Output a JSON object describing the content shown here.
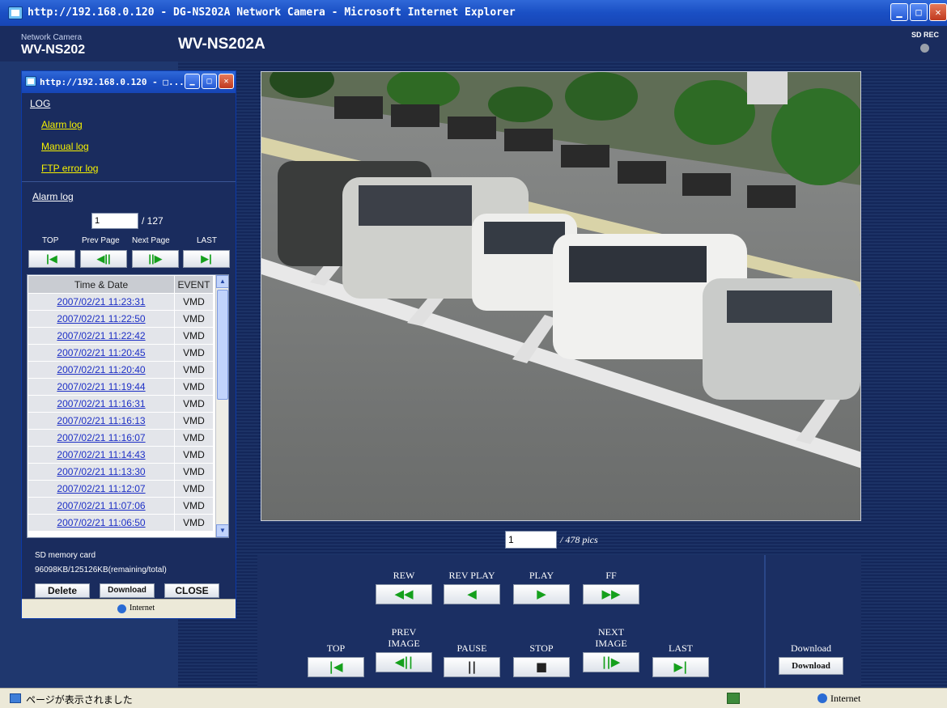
{
  "browser": {
    "title": "http://192.168.0.120 - DG-NS202A Network Camera - Microsoft Internet Explorer",
    "status_text": "ページが表示されました",
    "zone": "Internet"
  },
  "camera": {
    "label_small": "Network Camera",
    "model_small": "WV-NS202",
    "model": "WV-NS202A",
    "sd_rec": "SD REC"
  },
  "playback": {
    "current_pic": "1",
    "total_pics": "/ 478 pics",
    "rew": "REW",
    "rev_play": "REV PLAY",
    "play": "PLAY",
    "ff": "FF",
    "top": "TOP",
    "prev_line1": "PREV",
    "prev_line2": "IMAGE",
    "pause": "PAUSE",
    "stop": "STOP",
    "next_line1": "NEXT",
    "next_line2": "IMAGE",
    "last": "LAST",
    "download_label": "Download",
    "download_btn": "Download"
  },
  "popup": {
    "title": "http://192.168.0.120 - □...",
    "log_header": "LOG",
    "links": [
      "Alarm log",
      "Manual log",
      "FTP error log"
    ],
    "section_title": "Alarm log",
    "page_current": "1",
    "page_total": "/ 127",
    "nav": {
      "top": "TOP",
      "prev": "Prev Page",
      "next": "Next Page",
      "last": "LAST"
    },
    "columns": [
      "Time & Date",
      "EVENT"
    ],
    "rows": [
      [
        "2007/02/21 11:23:31",
        "VMD"
      ],
      [
        "2007/02/21 11:22:50",
        "VMD"
      ],
      [
        "2007/02/21 11:22:42",
        "VMD"
      ],
      [
        "2007/02/21 11:20:45",
        "VMD"
      ],
      [
        "2007/02/21 11:20:40",
        "VMD"
      ],
      [
        "2007/02/21 11:19:44",
        "VMD"
      ],
      [
        "2007/02/21 11:16:31",
        "VMD"
      ],
      [
        "2007/02/21 11:16:13",
        "VMD"
      ],
      [
        "2007/02/21 11:16:07",
        "VMD"
      ],
      [
        "2007/02/21 11:14:43",
        "VMD"
      ],
      [
        "2007/02/21 11:13:30",
        "VMD"
      ],
      [
        "2007/02/21 11:12:07",
        "VMD"
      ],
      [
        "2007/02/21 11:07:06",
        "VMD"
      ],
      [
        "2007/02/21 11:06:50",
        "VMD"
      ]
    ],
    "sd_label": "SD memory card",
    "sd_value": "96098KB/125126KB(remaining/total)",
    "delete": "Delete",
    "download": "Download",
    "close": "CLOSE",
    "zone": "Internet"
  },
  "colors": {
    "accent_green": "#15a01c",
    "link_yellow": "#f7f200",
    "bg_navy": "#1a2c5e"
  }
}
